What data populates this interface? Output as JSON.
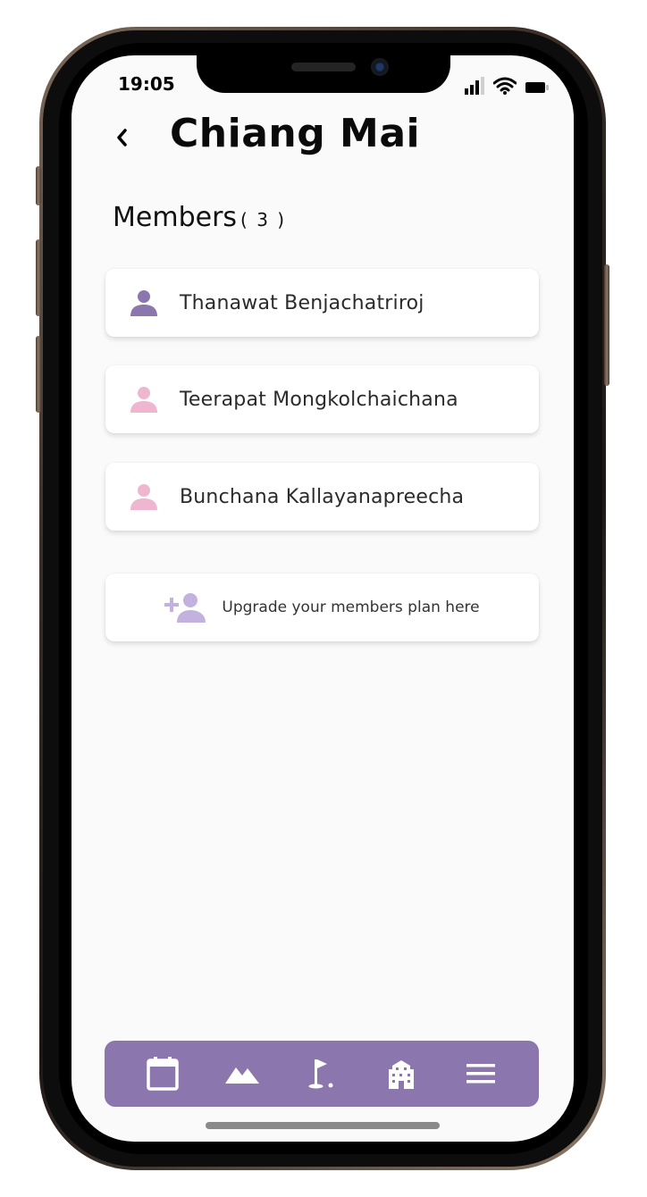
{
  "status_bar": {
    "time": "19:05"
  },
  "header": {
    "title": "Chiang Mai"
  },
  "members": {
    "heading": "Members",
    "count": "( 3 )",
    "items": [
      {
        "name": "Thanawat Benjachatriroj",
        "icon": "person-icon",
        "icon_color": "#8b77ae"
      },
      {
        "name": "Teerapat Mongkolchaichana",
        "icon": "person-icon",
        "icon_color": "#efb7cf"
      },
      {
        "name": "Bunchana Kallayanapreecha",
        "icon": "person-icon",
        "icon_color": "#efb7cf"
      }
    ]
  },
  "upgrade": {
    "label": "Upgrade your members plan here",
    "icon": "add-person-icon",
    "icon_color": "#c3b2dd"
  },
  "tab_bar": {
    "color": "#8b77ae",
    "tabs": [
      {
        "icon": "calendar-icon"
      },
      {
        "icon": "mountain-icon"
      },
      {
        "icon": "golf-flag-icon"
      },
      {
        "icon": "building-icon"
      },
      {
        "icon": "menu-icon"
      }
    ]
  }
}
